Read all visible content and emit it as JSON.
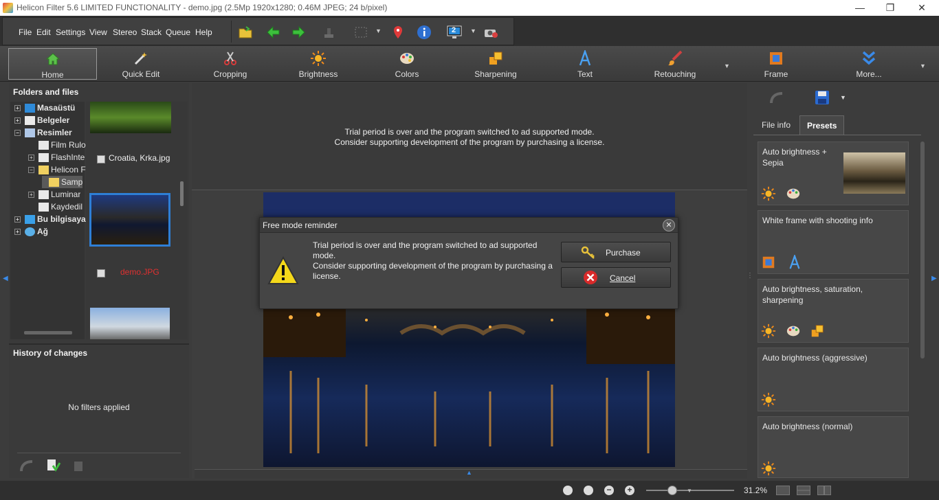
{
  "window": {
    "title": "Helicon Filter 5.6 LIMITED FUNCTIONALITY - demo.jpg (2.5Mp 1920x1280; 0.46M JPEG; 24 b/pixel)",
    "minimize": "—",
    "restore": "❐",
    "close": "✕"
  },
  "menu": {
    "items": [
      "File",
      "Edit",
      "Settings",
      "View",
      "Stereo",
      "Stack",
      "Queue",
      "Help"
    ]
  },
  "toolbar": {
    "monitor_badge": "2"
  },
  "ribbon": {
    "buttons": [
      {
        "label": "Home",
        "icon": "home-icon"
      },
      {
        "label": "Quick Edit",
        "icon": "magic-wand-icon"
      },
      {
        "label": "Cropping",
        "icon": "scissors-icon"
      },
      {
        "label": "Brightness",
        "icon": "sun-icon"
      },
      {
        "label": "Colors",
        "icon": "palette-icon"
      },
      {
        "label": "Sharpening",
        "icon": "sharpen-icon"
      },
      {
        "label": "Text",
        "icon": "text-a-icon"
      },
      {
        "label": "Retouching",
        "icon": "brush-icon"
      },
      {
        "label": "Frame",
        "icon": "frame-icon"
      },
      {
        "label": "More...",
        "icon": "chevron-double-down-icon"
      }
    ]
  },
  "folders": {
    "title": "Folders and files",
    "tree": [
      {
        "label": "Masaüstü",
        "bold": true,
        "level": 0,
        "exp": "+"
      },
      {
        "label": "Belgeler",
        "bold": true,
        "level": 0,
        "exp": "+"
      },
      {
        "label": "Resimler",
        "bold": true,
        "level": 0,
        "exp": "−"
      },
      {
        "label": "Film Rulo",
        "bold": false,
        "level": 1,
        "exp": ""
      },
      {
        "label": "FlashInte",
        "bold": false,
        "level": 1,
        "exp": "+"
      },
      {
        "label": "Helicon F",
        "bold": false,
        "level": 1,
        "exp": "−"
      },
      {
        "label": "Samp",
        "bold": false,
        "level": 2,
        "exp": ""
      },
      {
        "label": "Luminar",
        "bold": false,
        "level": 1,
        "exp": "+"
      },
      {
        "label": "Kaydedil",
        "bold": false,
        "level": 1,
        "exp": ""
      },
      {
        "label": "Bu bilgisaya",
        "bold": true,
        "level": 0,
        "exp": "+"
      },
      {
        "label": "Ağ",
        "bold": true,
        "level": 0,
        "exp": "+"
      }
    ],
    "files": [
      {
        "name": "Croatia, Krka.jpg"
      },
      {
        "name": "demo.JPG"
      }
    ]
  },
  "history": {
    "title": "History of changes",
    "empty": "No filters applied"
  },
  "ad": {
    "line1": "Trial period is over and the program switched to ad supported mode.",
    "line2": "Consider supporting development of the program by purchasing a license."
  },
  "dialog": {
    "title": "Free mode reminder",
    "message_1": "Trial period is over and the program switched to ad supported mode.",
    "message_2": "Consider supporting development of the program by purchasing a license.",
    "purchase": "Purchase",
    "cancel": "Cancel"
  },
  "right_panel": {
    "tabs": [
      "File info",
      "Presets"
    ],
    "active_tab": "Presets",
    "presets": [
      {
        "title": "Auto brightness + Sepia"
      },
      {
        "title": "White frame with shooting info"
      },
      {
        "title": "Auto brightness, saturation, sharpening"
      },
      {
        "title": "Auto brightness (aggressive)"
      },
      {
        "title": "Auto brightness (normal)"
      }
    ]
  },
  "status": {
    "zoom": "31.2%",
    "zoom_slider_fraction": 0.3
  },
  "colors": {
    "accent": "#2e7fd6",
    "error_text": "#e03030"
  }
}
